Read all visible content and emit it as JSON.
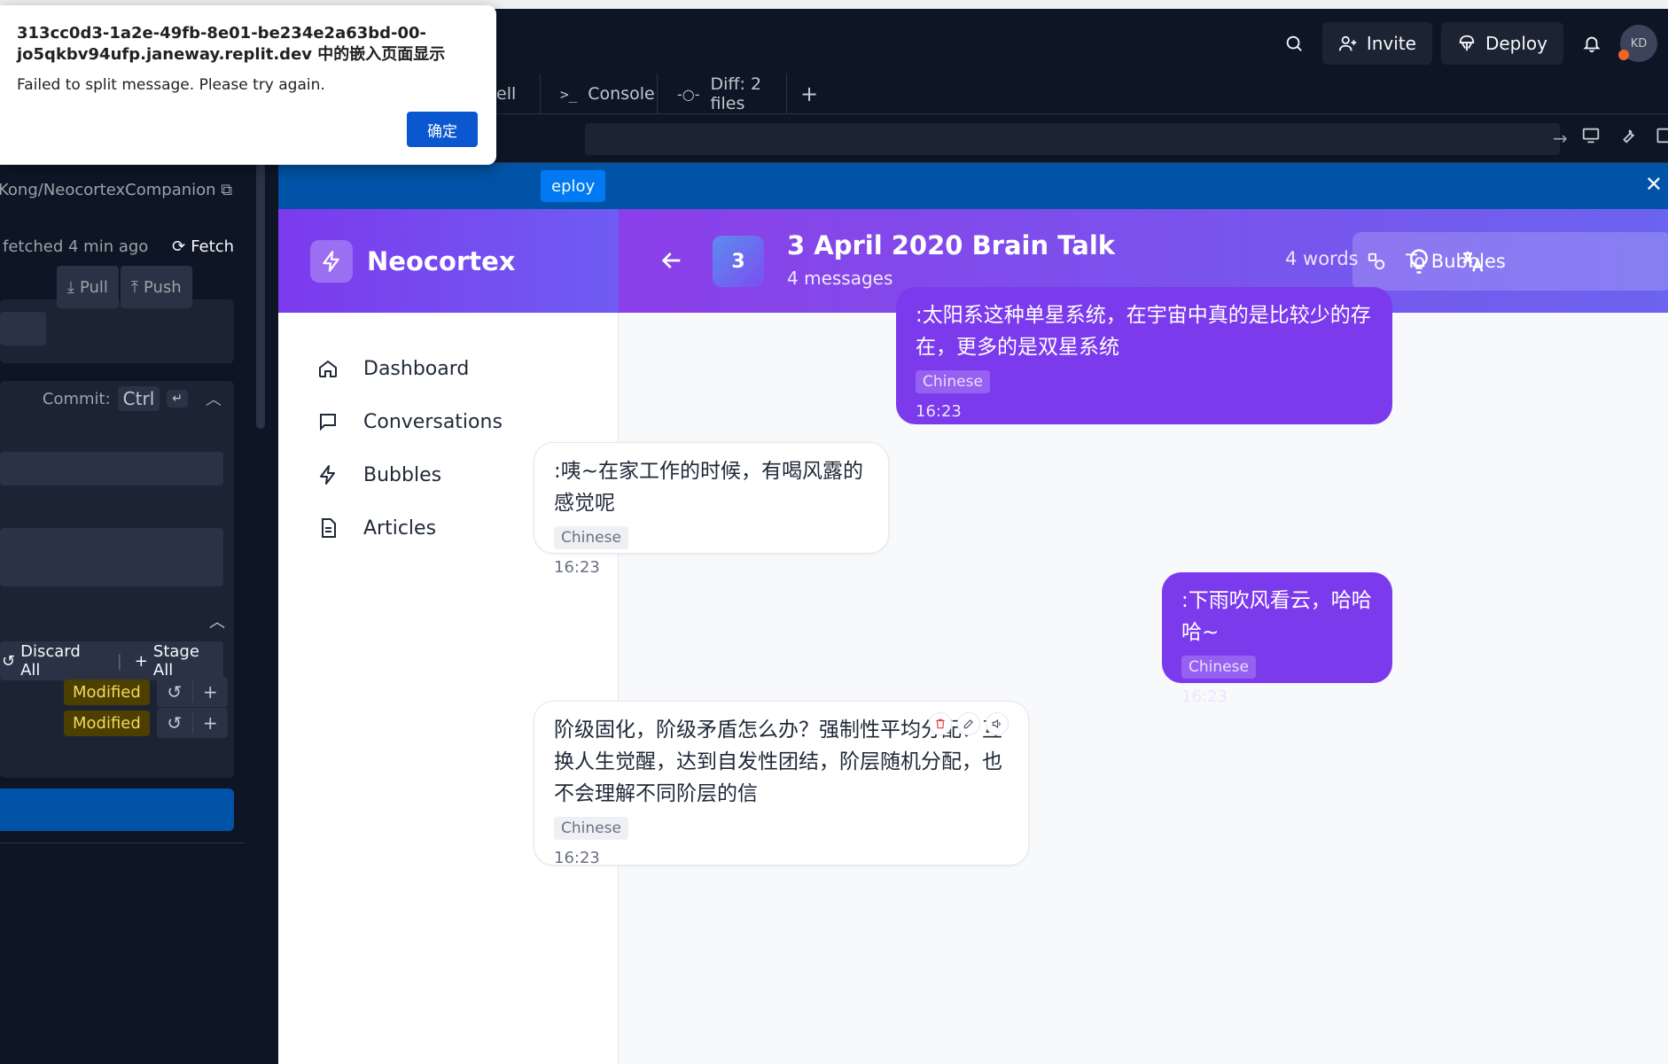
{
  "topbar": {
    "invite_label": "Invite",
    "deploy_label": "Deploy",
    "avatar_initials": "KD"
  },
  "tabs": {
    "shell_label": "ell",
    "console_label": "Console",
    "diff_label": "Diff: 2 files"
  },
  "banner": {
    "deploy_label": "eploy"
  },
  "git": {
    "repo_label": "Kong/NeocortexCompanion",
    "fetched_text": "fetched 4 min ago",
    "fetch_label": "Fetch",
    "pull_label": "Pull",
    "push_label": "Push",
    "commit_label": "Commit:",
    "commit_shortcut": "Ctrl",
    "discard_all_label": "Discard All",
    "stage_all_label": "Stage All",
    "files": [
      {
        "status": "Modified"
      },
      {
        "status": "Modified"
      }
    ]
  },
  "app": {
    "brand": "Neocortex",
    "nav": [
      {
        "label": "Dashboard",
        "icon": "home-icon"
      },
      {
        "label": "Conversations",
        "icon": "message-square-icon"
      },
      {
        "label": "Bubbles",
        "icon": "lightning-icon"
      },
      {
        "label": "Articles",
        "icon": "document-icon"
      }
    ],
    "conversation": {
      "number": "3",
      "title": "3 April 2020 Brain Talk",
      "subtitle": "4 messages",
      "word_count": "4 words",
      "to_bubbles_label": "To Bubbles"
    },
    "messages": [
      {
        "direction": "out",
        "text": ":太阳系这种单星系统，在宇宙中真的是比较少的存在，更多的是双星系统",
        "lang": "Chinese",
        "time": "16:23"
      },
      {
        "direction": "in",
        "text": ":咦~在家工作的时候，有喝风露的感觉呢",
        "lang": "Chinese",
        "time": "16:23"
      },
      {
        "direction": "out",
        "text": ":下雨吹风看云，哈哈哈~",
        "lang": "Chinese",
        "time": "16:23"
      },
      {
        "direction": "in",
        "text": "阶级固化，阶级矛盾怎么办？强制性平均分配？互换人生觉醒，达到自发性团结，阶层随机分配，也不会理解不同阶层的信",
        "lang": "Chinese",
        "time": "16:23"
      }
    ]
  },
  "dialog": {
    "title": "313cc0d3-1a2e-49fb-8e01-be234e2a63bd-00-jo5qkbv94ufp.janeway.replit.dev 中的嵌入页面显示",
    "message": "Failed to split message. Please try again.",
    "ok_label": "确定"
  },
  "colors": {
    "replit_bg": "#0e1525",
    "replit_panel": "#1c2333",
    "banner": "#0053a6",
    "brand_purple": "#7c3aed",
    "modified_badge": "#f2d95d",
    "dialog_button": "#0b57d0"
  }
}
